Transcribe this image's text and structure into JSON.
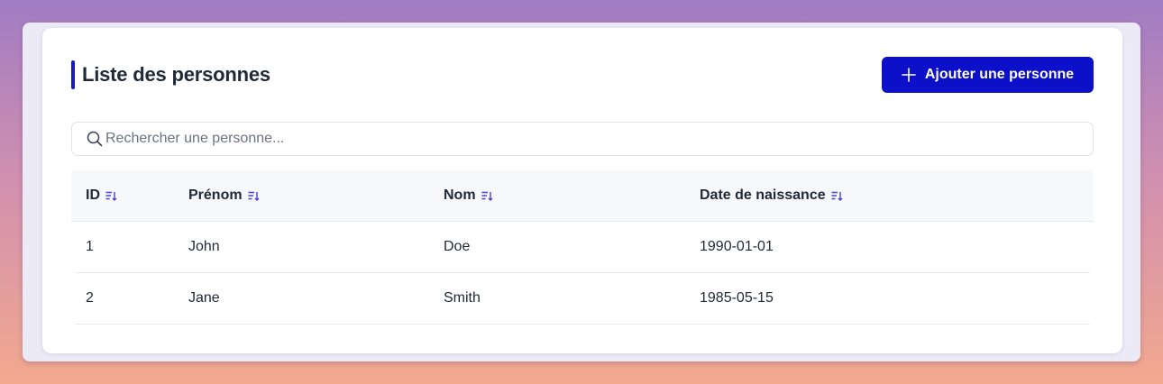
{
  "page": {
    "title": "Liste des personnes",
    "add_button_label": "Ajouter une personne"
  },
  "search": {
    "placeholder": "Rechercher une personne...",
    "value": ""
  },
  "table": {
    "columns": [
      {
        "label": "ID",
        "sort_icon": "sort-icon"
      },
      {
        "label": "Prénom",
        "sort_icon": "sort-icon"
      },
      {
        "label": "Nom",
        "sort_icon": "sort-icon"
      },
      {
        "label": "Date de naissance",
        "sort_icon": "sort-icon"
      }
    ],
    "rows": [
      {
        "id": "1",
        "prenom": "John",
        "nom": "Doe",
        "date": "1990-01-01"
      },
      {
        "id": "2",
        "prenom": "Jane",
        "nom": "Smith",
        "date": "1985-05-15"
      }
    ]
  },
  "colors": {
    "accent": "#0c10c9",
    "title_bar": "#1a17c9",
    "sort_icon": "#4b3fd6"
  },
  "icons": {
    "add": "plus-icon",
    "search": "search-icon",
    "sort": "sort-icon"
  }
}
